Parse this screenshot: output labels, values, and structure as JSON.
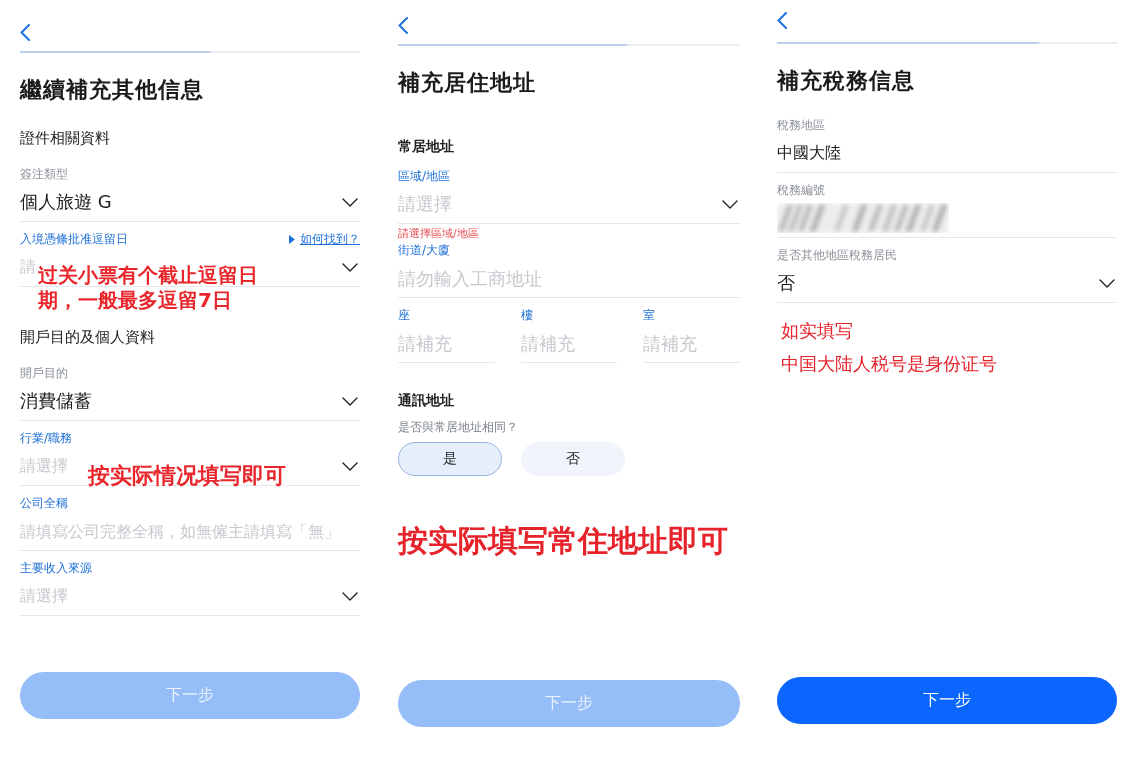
{
  "screens": [
    {
      "progress": {
        "level": 0.56
      },
      "title": "繼續補充其他信息",
      "sections": [
        {
          "heading": "證件相關資料",
          "fields": [
            {
              "kind": "select",
              "label": "簽注類型",
              "value": "個人旅遊 G"
            },
            {
              "kind": "select",
              "label": "入境憑條批准逗留日",
              "help_link": "如何找到？",
              "placeholder": "請",
              "annotation": "过关小票有个截止逗留日期，一般最多逗留7日"
            }
          ]
        },
        {
          "heading": "開戶目的及個人資料",
          "fields": [
            {
              "kind": "select",
              "label": "開戶目的",
              "value": "消費儲蓄"
            },
            {
              "kind": "select",
              "label": "行業/職務",
              "placeholder": "請選擇",
              "annotation": "按实际情况填写即可"
            },
            {
              "kind": "text",
              "label": "公司全稱",
              "placeholder": "請填寫公司完整全稱，如無僱主請填寫「無」"
            },
            {
              "kind": "select",
              "label": "主要收入來源",
              "placeholder": "請選擇"
            }
          ]
        }
      ],
      "next_button": {
        "label": "下一步",
        "disabled": true
      }
    },
    {
      "progress": {
        "level": 0.67
      },
      "title": "補充居住地址",
      "sections": [
        {
          "heading": "常居地址",
          "fields": [
            {
              "kind": "select",
              "label": "區域/地區",
              "placeholder": "請選擇",
              "error": "請選擇區域/地區"
            },
            {
              "kind": "text",
              "label": "街道/大廈",
              "placeholder": "請勿輸入工商地址"
            },
            {
              "kind": "split",
              "columns": [
                {
                  "label": "座",
                  "placeholder": "請補充"
                },
                {
                  "label": "樓",
                  "placeholder": "請補充"
                },
                {
                  "label": "室",
                  "placeholder": "請補充"
                }
              ]
            }
          ]
        },
        {
          "heading": "通訊地址",
          "fields": [
            {
              "kind": "choice",
              "question": "是否與常居地址相同？",
              "options": [
                {
                  "label": "是",
                  "selected": true
                },
                {
                  "label": "否",
                  "selected": false
                }
              ]
            }
          ]
        }
      ],
      "notes": [
        {
          "kind": "headline",
          "text": "按实际填写常住地址即可"
        }
      ],
      "next_button": {
        "label": "下一步",
        "disabled": true
      }
    },
    {
      "progress": {
        "level": 0.77
      },
      "title": "補充稅務信息",
      "sections": [
        {
          "fields": [
            {
              "kind": "text",
              "label": "稅務地區",
              "value": "中國大陸"
            },
            {
              "kind": "blurred",
              "label": "稅務編號"
            },
            {
              "kind": "select",
              "label": "是否其他地區稅務居民",
              "value": "否"
            }
          ]
        }
      ],
      "notes": [
        {
          "kind": "plain",
          "text": "如实填写"
        },
        {
          "kind": "plain",
          "text": "中国大陆人税号是身份证号"
        }
      ],
      "next_button": {
        "label": "下一步",
        "disabled": false
      }
    }
  ]
}
